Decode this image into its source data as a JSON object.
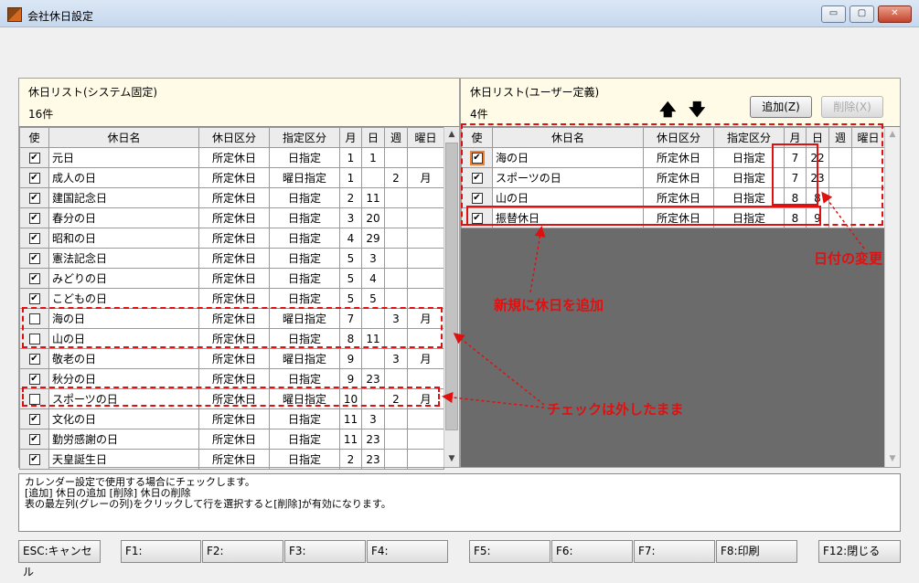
{
  "window": {
    "title": "会社休日設定",
    "btn_min": "▭",
    "btn_max": "▢",
    "btn_close": "✕"
  },
  "left": {
    "title": "休日リスト(システム固定)",
    "count": "16件",
    "headers": [
      "使",
      "休日名",
      "休日区分",
      "指定区分",
      "月",
      "日",
      "週",
      "曜日"
    ],
    "rows": [
      {
        "checked": true,
        "name": "元日",
        "kubun": "所定休日",
        "shitei": "日指定",
        "month": "1",
        "day": "1",
        "week": "",
        "youbi": ""
      },
      {
        "checked": true,
        "name": "成人の日",
        "kubun": "所定休日",
        "shitei": "曜日指定",
        "month": "1",
        "day": "",
        "week": "2",
        "youbi": "月"
      },
      {
        "checked": true,
        "name": "建国記念日",
        "kubun": "所定休日",
        "shitei": "日指定",
        "month": "2",
        "day": "11",
        "week": "",
        "youbi": ""
      },
      {
        "checked": true,
        "name": "春分の日",
        "kubun": "所定休日",
        "shitei": "日指定",
        "month": "3",
        "day": "20",
        "week": "",
        "youbi": ""
      },
      {
        "checked": true,
        "name": "昭和の日",
        "kubun": "所定休日",
        "shitei": "日指定",
        "month": "4",
        "day": "29",
        "week": "",
        "youbi": ""
      },
      {
        "checked": true,
        "name": "憲法記念日",
        "kubun": "所定休日",
        "shitei": "日指定",
        "month": "5",
        "day": "3",
        "week": "",
        "youbi": ""
      },
      {
        "checked": true,
        "name": "みどりの日",
        "kubun": "所定休日",
        "shitei": "日指定",
        "month": "5",
        "day": "4",
        "week": "",
        "youbi": ""
      },
      {
        "checked": true,
        "name": "こどもの日",
        "kubun": "所定休日",
        "shitei": "日指定",
        "month": "5",
        "day": "5",
        "week": "",
        "youbi": ""
      },
      {
        "checked": false,
        "name": "海の日",
        "kubun": "所定休日",
        "shitei": "曜日指定",
        "month": "7",
        "day": "",
        "week": "3",
        "youbi": "月"
      },
      {
        "checked": false,
        "name": "山の日",
        "kubun": "所定休日",
        "shitei": "日指定",
        "month": "8",
        "day": "11",
        "week": "",
        "youbi": ""
      },
      {
        "checked": true,
        "name": "敬老の日",
        "kubun": "所定休日",
        "shitei": "曜日指定",
        "month": "9",
        "day": "",
        "week": "3",
        "youbi": "月"
      },
      {
        "checked": true,
        "name": "秋分の日",
        "kubun": "所定休日",
        "shitei": "日指定",
        "month": "9",
        "day": "23",
        "week": "",
        "youbi": ""
      },
      {
        "checked": false,
        "name": "スポーツの日",
        "kubun": "所定休日",
        "shitei": "曜日指定",
        "month": "10",
        "day": "",
        "week": "2",
        "youbi": "月"
      },
      {
        "checked": true,
        "name": "文化の日",
        "kubun": "所定休日",
        "shitei": "日指定",
        "month": "11",
        "day": "3",
        "week": "",
        "youbi": ""
      },
      {
        "checked": true,
        "name": "勤労感謝の日",
        "kubun": "所定休日",
        "shitei": "日指定",
        "month": "11",
        "day": "23",
        "week": "",
        "youbi": ""
      },
      {
        "checked": true,
        "name": "天皇誕生日",
        "kubun": "所定休日",
        "shitei": "日指定",
        "month": "2",
        "day": "23",
        "week": "",
        "youbi": ""
      }
    ]
  },
  "right": {
    "title": "休日リスト(ユーザー定義)",
    "count": "4件",
    "up_arrow": "🡅",
    "down_arrow": "🡇",
    "add_button": "追加(Z)",
    "delete_button": "削除(X)",
    "headers": [
      "使",
      "休日名",
      "休日区分",
      "指定区分",
      "月",
      "日",
      "週",
      "曜日"
    ],
    "rows": [
      {
        "checked": true,
        "name": "海の日",
        "kubun": "所定休日",
        "shitei": "日指定",
        "month": "7",
        "day": "22",
        "week": "",
        "youbi": ""
      },
      {
        "checked": true,
        "name": "スポーツの日",
        "kubun": "所定休日",
        "shitei": "日指定",
        "month": "7",
        "day": "23",
        "week": "",
        "youbi": ""
      },
      {
        "checked": true,
        "name": "山の日",
        "kubun": "所定休日",
        "shitei": "日指定",
        "month": "8",
        "day": "8",
        "week": "",
        "youbi": ""
      },
      {
        "checked": true,
        "name": "振替休日",
        "kubun": "所定休日",
        "shitei": "日指定",
        "month": "8",
        "day": "9",
        "week": "",
        "youbi": ""
      }
    ]
  },
  "message": {
    "line1": "カレンダー設定で使用する場合にチェックします。",
    "line2": "[追加] 休日の追加 [削除] 休日の削除",
    "line3": "表の最左列(グレーの列)をクリックして行を選択すると[削除]が有効になります。"
  },
  "fkeys": [
    "ESC:キャンセル",
    "F1:",
    "F2:",
    "F3:",
    "F4:",
    "F5:",
    "F6:",
    "F7:",
    "F8:印刷",
    "F12:閉じる"
  ],
  "annotations": {
    "date_change": "日付の変更",
    "add_new": "新規に休日を追加",
    "keep_unchecked": "チェックは外したまま"
  },
  "scroll": {
    "left_up": "▲",
    "left_down": "▼",
    "right_up": "▲",
    "right_down": "▼"
  },
  "colors": {
    "annotation": "#e01010",
    "panel_bg": "#fffbe6",
    "empty_grid": "#6b6b6b"
  }
}
